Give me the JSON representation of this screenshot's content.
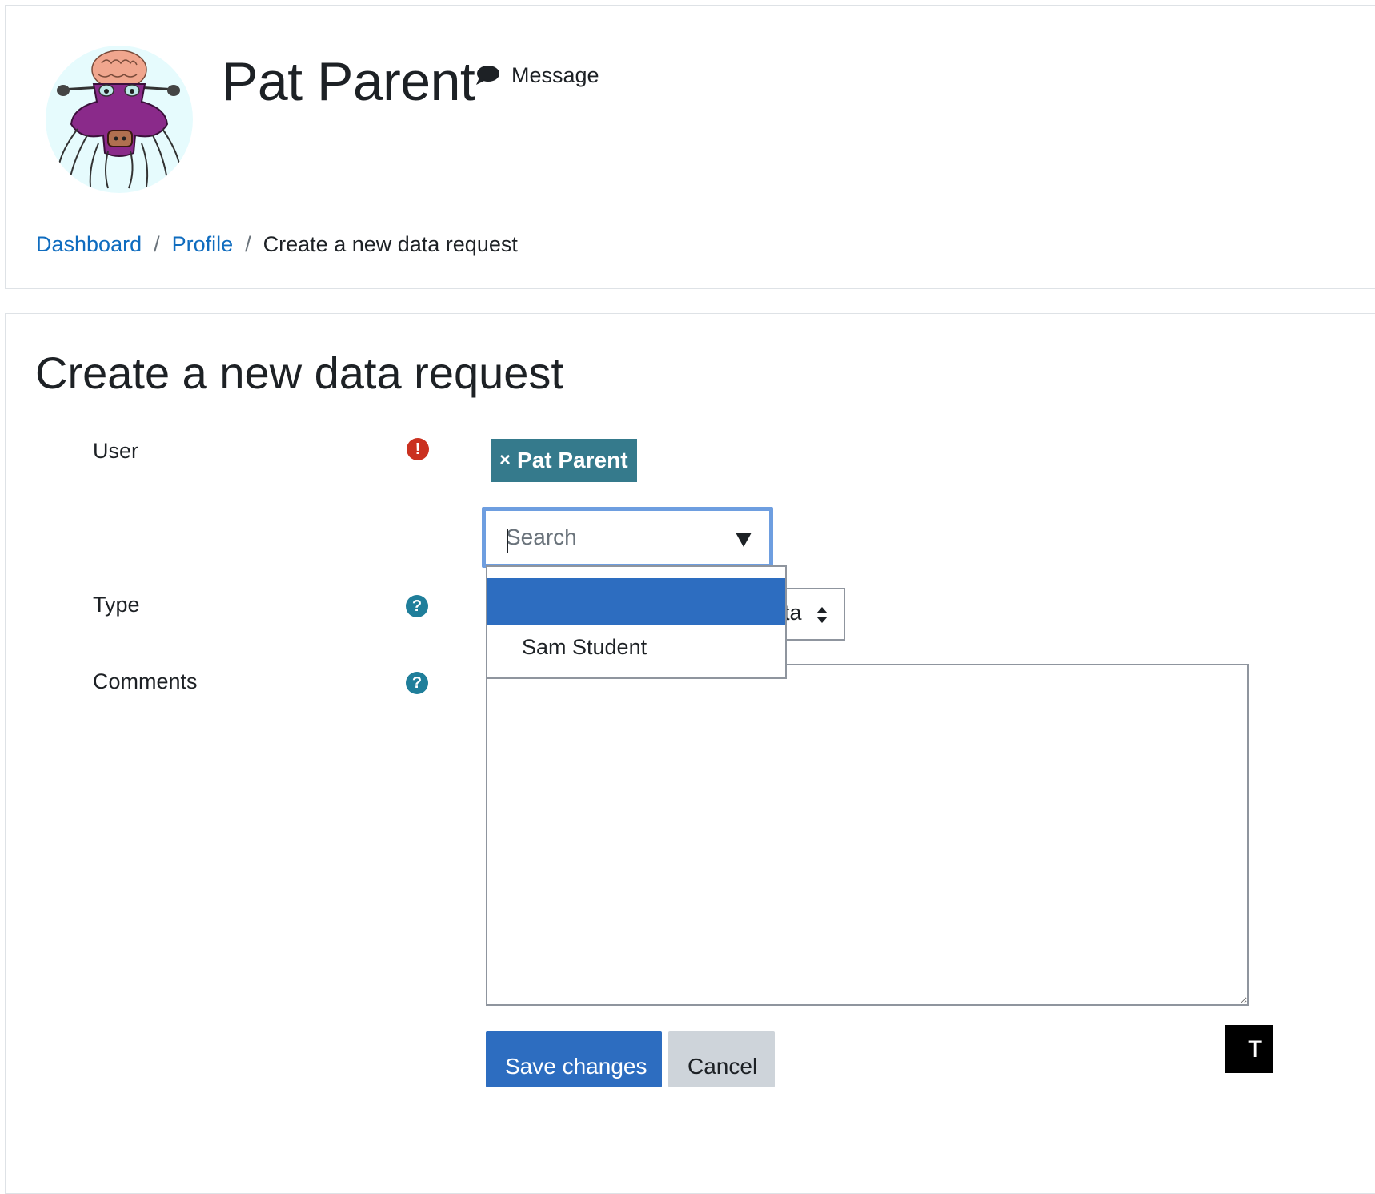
{
  "profile": {
    "name": "Pat Parent",
    "message_label": "Message"
  },
  "breadcrumb": {
    "items": [
      {
        "label": "Dashboard"
      },
      {
        "label": "Profile"
      },
      {
        "label": "Create a new data request"
      }
    ],
    "separator": "/"
  },
  "page": {
    "heading": "Create a new data request"
  },
  "form": {
    "user": {
      "label": "User",
      "selected": "Pat Parent",
      "remove_glyph": "×",
      "search_placeholder": "Search",
      "options": [
        "",
        "Sam Student"
      ]
    },
    "type": {
      "label": "Type",
      "visible_value_fragment": "ta"
    },
    "comments": {
      "label": "Comments",
      "value": ""
    },
    "save_label": "Save changes",
    "cancel_label": "Cancel"
  },
  "icons": {
    "required": "exclamation-icon",
    "help": "question-icon",
    "message": "speech-bubble-icon"
  },
  "colors": {
    "link": "#0f6cbf",
    "primary": "#2d6dc0",
    "tag": "#357a8c",
    "required": "#ca3120",
    "help": "#1f7e9a",
    "focus": "#6e9ee0"
  },
  "corner": {
    "text": "T"
  }
}
